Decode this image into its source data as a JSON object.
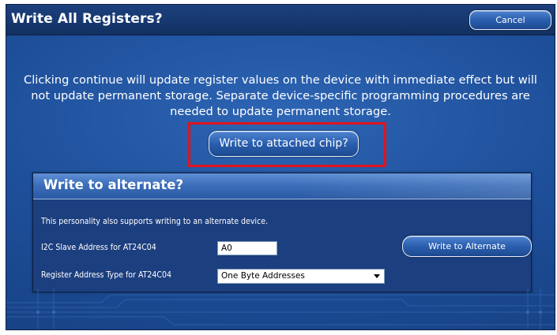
{
  "dialog": {
    "title": "Write All Registers?",
    "cancel_label": "Cancel",
    "description": "Clicking continue will update register values on the device with immediate effect but will not update permanent storage. Separate device-specific programming procedures are needed to update permanent storage.",
    "write_chip_label": "Write to attached chip?"
  },
  "alternate": {
    "heading": "Write to alternate?",
    "support_text": "This personality also supports writing to an alternate device.",
    "address_label": "I2C Slave Address for AT24C04",
    "address_value": "A0",
    "type_label": "Register Address Type for AT24C04",
    "type_selected": "One Byte Addresses",
    "write_button_label": "Write to Alternate"
  },
  "colors": {
    "background": "#1e4f9a",
    "titlebar": "#183a73",
    "highlight": "#e0141b",
    "panel": "#1c3f7f"
  }
}
